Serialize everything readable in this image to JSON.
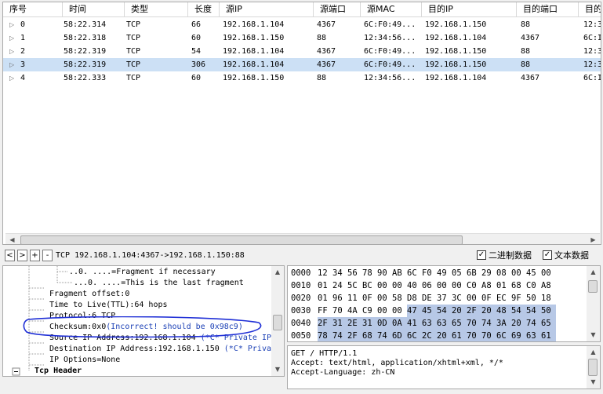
{
  "packet_list": {
    "headers": [
      "序号",
      "时间",
      "类型",
      "长度",
      "源IP",
      "源端口",
      "源MAC",
      "目的IP",
      "目的端口",
      "目的"
    ],
    "rows": [
      {
        "no": "0",
        "time": "58:22.314",
        "type": "TCP",
        "len": "66",
        "src_ip": "192.168.1.104",
        "src_port": "4367",
        "src_mac": "6C:F0:49...",
        "dst_ip": "192.168.1.150",
        "dst_port": "88",
        "dst": "12:3"
      },
      {
        "no": "1",
        "time": "58:22.318",
        "type": "TCP",
        "len": "60",
        "src_ip": "192.168.1.150",
        "src_port": "88",
        "src_mac": "12:34:56...",
        "dst_ip": "192.168.1.104",
        "dst_port": "4367",
        "dst": "6C:I"
      },
      {
        "no": "2",
        "time": "58:22.319",
        "type": "TCP",
        "len": "54",
        "src_ip": "192.168.1.104",
        "src_port": "4367",
        "src_mac": "6C:F0:49...",
        "dst_ip": "192.168.1.150",
        "dst_port": "88",
        "dst": "12:3"
      },
      {
        "no": "3",
        "time": "58:22.319",
        "type": "TCP",
        "len": "306",
        "src_ip": "192.168.1.104",
        "src_port": "4367",
        "src_mac": "6C:F0:49...",
        "dst_ip": "192.168.1.150",
        "dst_port": "88",
        "dst": "12:3"
      },
      {
        "no": "4",
        "time": "58:22.333",
        "type": "TCP",
        "len": "60",
        "src_ip": "192.168.1.150",
        "src_port": "88",
        "src_mac": "12:34:56...",
        "dst_ip": "192.168.1.104",
        "dst_port": "4367",
        "dst": "6C:I"
      }
    ],
    "selected_row": 3
  },
  "toolbar": {
    "nav": [
      "<",
      ">",
      "+",
      "-"
    ],
    "summary": "TCP 192.168.1.104:4367->192.168.1.150:88",
    "binary_label": "二进制数据",
    "text_label": "文本数据",
    "binary_checked": true,
    "text_checked": true
  },
  "tree": {
    "lines": [
      {
        "text": "..0. ....=Fragment if necessary",
        "extra": ""
      },
      {
        "text": "...0. ....=This is the last fragment",
        "extra": ""
      },
      {
        "text": "Fragment offset:0",
        "extra": ""
      },
      {
        "text": "Time to Live(TTL):64 hops",
        "extra": ""
      },
      {
        "text": "Protocol:6 TCP",
        "extra": ""
      },
      {
        "text": "Checksum:0x0",
        "extra": "(Incorrect! should be 0x98c9)"
      },
      {
        "text": "Source IP Address:192.168.1.104",
        "extra": "(*C* Private IP)"
      },
      {
        "text": "Destination IP Address:192.168.1.150",
        "extra": "(*C* Priva"
      },
      {
        "text": "IP Options=None",
        "extra": ""
      },
      {
        "text": "Tcp Header",
        "extra": ""
      }
    ]
  },
  "hex": {
    "rows": [
      {
        "offset": "0000",
        "bytes": [
          "12",
          "34",
          "56",
          "78",
          "90",
          "AB",
          "6C",
          "F0",
          "49",
          "05",
          "6B",
          "29",
          "08",
          "00",
          "45",
          "00"
        ]
      },
      {
        "offset": "0010",
        "bytes": [
          "01",
          "24",
          "5C",
          "BC",
          "00",
          "00",
          "40",
          "06",
          "00",
          "00",
          "C0",
          "A8",
          "01",
          "68",
          "C0",
          "A8"
        ]
      },
      {
        "offset": "0020",
        "bytes": [
          "01",
          "96",
          "11",
          "0F",
          "00",
          "58",
          "D8",
          "DE",
          "37",
          "3C",
          "00",
          "0F",
          "EC",
          "9F",
          "50",
          "18"
        ]
      },
      {
        "offset": "0030",
        "bytes": [
          "FF",
          "70",
          "4A",
          "C9",
          "00",
          "00",
          "47",
          "45",
          "54",
          "20",
          "2F",
          "20",
          "48",
          "54",
          "54",
          "50"
        ]
      },
      {
        "offset": "0040",
        "bytes": [
          "2F",
          "31",
          "2E",
          "31",
          "0D",
          "0A",
          "41",
          "63",
          "63",
          "65",
          "70",
          "74",
          "3A",
          "20",
          "74",
          "65"
        ]
      },
      {
        "offset": "0050",
        "bytes": [
          "78",
          "74",
          "2F",
          "68",
          "74",
          "6D",
          "6C",
          "2C",
          "20",
          "61",
          "70",
          "70",
          "6C",
          "69",
          "63",
          "61"
        ]
      }
    ]
  },
  "text_view": {
    "lines": [
      "GET / HTTP/1.1",
      "Accept: text/html, application/xhtml+xml, */*",
      "Accept-Language: zh-CN"
    ]
  },
  "colors": {
    "selection": "#cce0f5",
    "hex_highlight": "#b7c8e6",
    "annotation_circle": "#1f2fd6"
  }
}
